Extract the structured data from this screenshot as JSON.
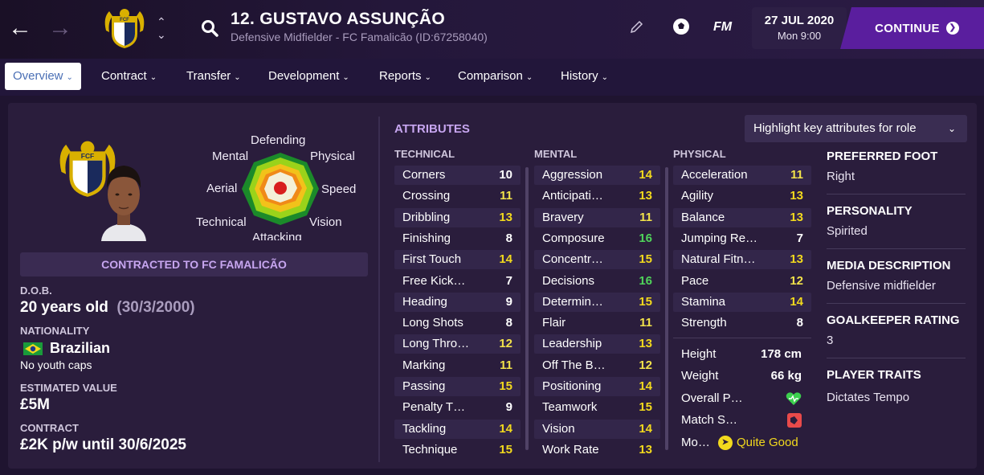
{
  "header": {
    "player_title": "12. GUSTAVO ASSUNÇÃO",
    "subtitle": "Defensive Midfielder - FC Famalicão (ID:67258040)",
    "fm_logo": "FM",
    "date": "27 JUL 2020",
    "time": "Mon 9:00",
    "continue_label": "CONTINUE",
    "icons": [
      "back-arrow-icon",
      "forward-arrow-icon",
      "club-crest-icon",
      "chevron-up-icon",
      "chevron-down-icon",
      "search-icon",
      "pencil-icon",
      "football-icon",
      "continue-arrow-icon"
    ]
  },
  "tabs": [
    {
      "label": "Overview",
      "active": true
    },
    {
      "label": "Contract"
    },
    {
      "label": "Transfer"
    },
    {
      "label": "Development"
    },
    {
      "label": "Reports"
    },
    {
      "label": "Comparison"
    },
    {
      "label": "History"
    }
  ],
  "radar": {
    "labels": {
      "top": "Defending",
      "top_left": "Mental",
      "top_right": "Physical",
      "left": "Aerial",
      "right": "Speed",
      "bottom_left": "Technical",
      "bottom_right": "Vision",
      "bottom": "Attacking"
    }
  },
  "profile": {
    "contracted": "CONTRACTED TO FC FAMALICÃO",
    "dob_label": "D.O.B.",
    "age": "20 years old",
    "dob": "(30/3/2000)",
    "nationality_label": "NATIONALITY",
    "nationality": "Brazilian",
    "youth_caps": "No youth caps",
    "value_label": "ESTIMATED VALUE",
    "value": "£5M",
    "contract_label": "CONTRACT",
    "contract": "£2K p/w until 30/6/2025"
  },
  "attributes": {
    "title": "ATTRIBUTES",
    "highlight_label": "Highlight key attributes for role",
    "technical_header": "TECHNICAL",
    "mental_header": "MENTAL",
    "physical_header": "PHYSICAL",
    "technical": [
      {
        "name": "Corners",
        "value": "10"
      },
      {
        "name": "Crossing",
        "value": "11"
      },
      {
        "name": "Dribbling",
        "value": "13"
      },
      {
        "name": "Finishing",
        "value": "8"
      },
      {
        "name": "First Touch",
        "value": "14"
      },
      {
        "name": "Free Kick…",
        "value": "7"
      },
      {
        "name": "Heading",
        "value": "9"
      },
      {
        "name": "Long Shots",
        "value": "8"
      },
      {
        "name": "Long Thro…",
        "value": "12"
      },
      {
        "name": "Marking",
        "value": "11"
      },
      {
        "name": "Passing",
        "value": "15"
      },
      {
        "name": "Penalty T…",
        "value": "9"
      },
      {
        "name": "Tackling",
        "value": "14"
      },
      {
        "name": "Technique",
        "value": "15"
      }
    ],
    "mental": [
      {
        "name": "Aggression",
        "value": "14"
      },
      {
        "name": "Anticipati…",
        "value": "13"
      },
      {
        "name": "Bravery",
        "value": "11"
      },
      {
        "name": "Composure",
        "value": "16"
      },
      {
        "name": "Concentr…",
        "value": "15"
      },
      {
        "name": "Decisions",
        "value": "16"
      },
      {
        "name": "Determin…",
        "value": "15"
      },
      {
        "name": "Flair",
        "value": "11"
      },
      {
        "name": "Leadership",
        "value": "13"
      },
      {
        "name": "Off The B…",
        "value": "12"
      },
      {
        "name": "Positioning",
        "value": "14"
      },
      {
        "name": "Teamwork",
        "value": "15"
      },
      {
        "name": "Vision",
        "value": "14"
      },
      {
        "name": "Work Rate",
        "value": "13"
      }
    ],
    "physical": [
      {
        "name": "Acceleration",
        "value": "11"
      },
      {
        "name": "Agility",
        "value": "13"
      },
      {
        "name": "Balance",
        "value": "13"
      },
      {
        "name": "Jumping Re…",
        "value": "7"
      },
      {
        "name": "Natural Fitn…",
        "value": "13"
      },
      {
        "name": "Pace",
        "value": "12"
      },
      {
        "name": "Stamina",
        "value": "14"
      },
      {
        "name": "Strength",
        "value": "8"
      }
    ],
    "extra": {
      "height_label": "Height",
      "height": "178 cm",
      "weight_label": "Weight",
      "weight": "66 kg",
      "overall_label": "Overall P…",
      "match_label": "Match S…",
      "morale_label": "Mo…",
      "morale": "Quite Good"
    }
  },
  "side": {
    "foot_label": "PREFERRED FOOT",
    "foot": "Right",
    "personality_label": "PERSONALITY",
    "personality": "Spirited",
    "media_label": "MEDIA DESCRIPTION",
    "media": "Defensive midfielder",
    "gk_label": "GOALKEEPER RATING",
    "gk": "3",
    "traits_label": "PLAYER TRAITS",
    "traits": "Dictates Tempo"
  },
  "colors": {
    "accent": "#5a1e9e",
    "attr_title": "#c7a6f0",
    "high": "#4fd35a",
    "mid": "#f2d91d"
  }
}
